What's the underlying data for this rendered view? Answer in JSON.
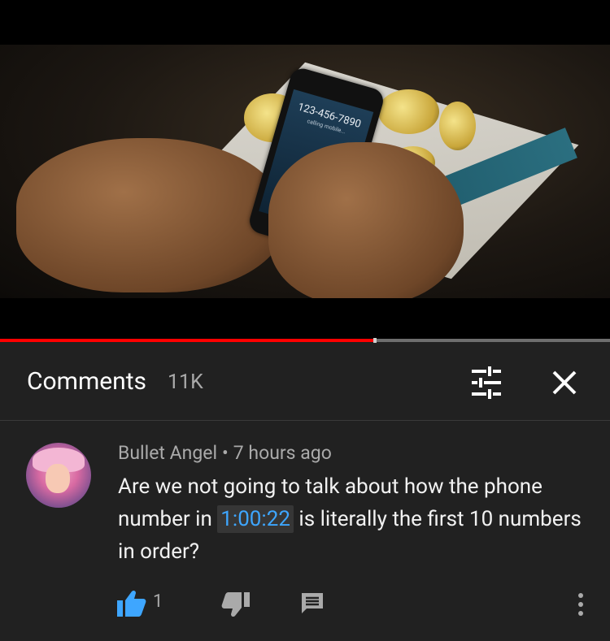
{
  "video": {
    "phone_number": "123-456-7890",
    "phone_status": "calling mobile...",
    "progress_fraction": 0.615
  },
  "comments_header": {
    "title": "Comments",
    "count": "11K",
    "icons": [
      "filter-sort-icon",
      "close-icon"
    ]
  },
  "comment": {
    "author": "Bullet Angel",
    "separator": "•",
    "time": "7 hours ago",
    "text_before": "Are we not going to talk about how the phone number in ",
    "timestamp": "1:00:22",
    "text_after": " is literally the first 10 numbers in order?",
    "likes": "1",
    "colors": {
      "link": "#3ea6ff",
      "like_active": "#3ea6ff"
    }
  }
}
